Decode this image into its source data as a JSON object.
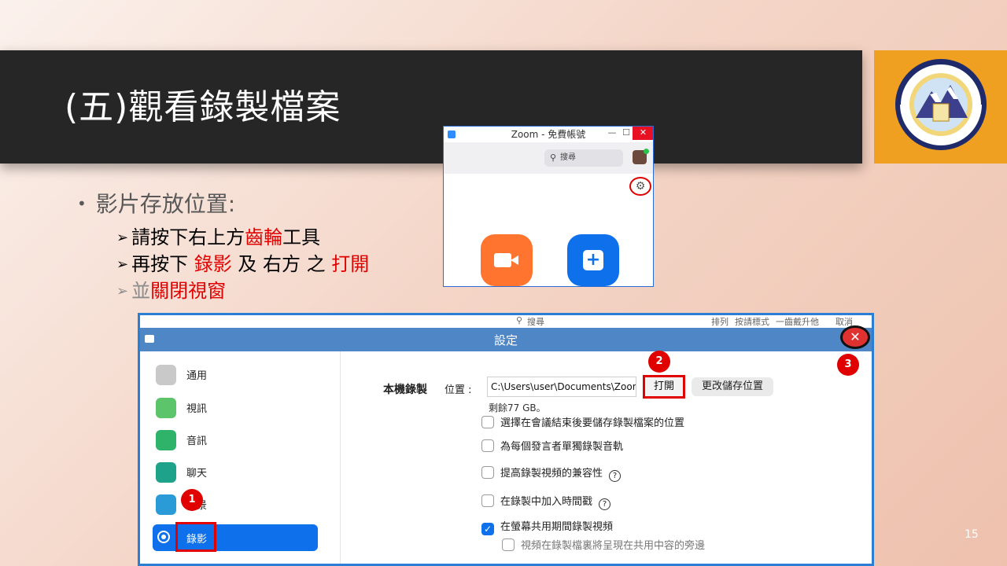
{
  "slide": {
    "title": "(五)觀看錄製檔案",
    "page_number": "15",
    "logo_seal_text": "國立嘉義大學 NATIONAL CHIAYI UNIVERSITY 嘉大"
  },
  "bullets": {
    "main": "影片存放位置:",
    "sub1_a": "請按下右上方",
    "sub1_b": "齒輪",
    "sub1_c": "工具",
    "sub2_a": "再按下 ",
    "sub2_b": "錄影",
    "sub2_c": " 及 右方 之 ",
    "sub2_d": "打開",
    "sub3_a": "並",
    "sub3_b": "關閉視窗"
  },
  "zoom_window": {
    "title": "Zoom - 免費帳號",
    "search_placeholder": "搜尋",
    "min_label": "—",
    "max_label": "☐",
    "close_label": "✕"
  },
  "settings": {
    "ghost_search": "搜尋",
    "ghost_sort_label": "排列",
    "ghost_sort_value": "按請標式",
    "ghost_right": "一齒戴升他",
    "ghost_cancel": "取消",
    "title": "設定",
    "close_label": "✕",
    "nav": [
      {
        "label": "通用"
      },
      {
        "label": "視訊"
      },
      {
        "label": "音訊"
      },
      {
        "label": "聊天"
      },
      {
        "label": "背景"
      },
      {
        "label": "錄影"
      }
    ],
    "local_recording_label": "本機錄製",
    "location_label": "位置 :",
    "path_value": "C:\\Users\\user\\Documents\\Zoom",
    "open_button": "打開",
    "change_button": "更改儲存位置",
    "free_space": "剩餘77 GB。",
    "options": [
      {
        "label": "選擇在會議結束後要儲存錄製檔案的位置",
        "checked": false
      },
      {
        "label": "為每個發言者單獨錄製音軌",
        "checked": false
      },
      {
        "label": "提高錄製視頻的兼容性",
        "checked": false
      },
      {
        "label": "在錄製中加入時間戳",
        "checked": false
      },
      {
        "label": "在螢幕共用期間錄製視頻",
        "checked": true
      }
    ],
    "help_glyph": "?",
    "check_glyph": "✓",
    "partial_option": "視頻在錄製檔裏將呈現在共用中容的旁邊"
  },
  "markers": {
    "m1": "1",
    "m2": "2",
    "m3": "3"
  },
  "colors": {
    "title_bg": "#262626",
    "logo_bg": "#f0a020",
    "highlight_red": "#e00000",
    "zoom_blue": "#0e71eb",
    "zoom_orange": "#ff742e",
    "settings_header": "#4f86c6"
  }
}
